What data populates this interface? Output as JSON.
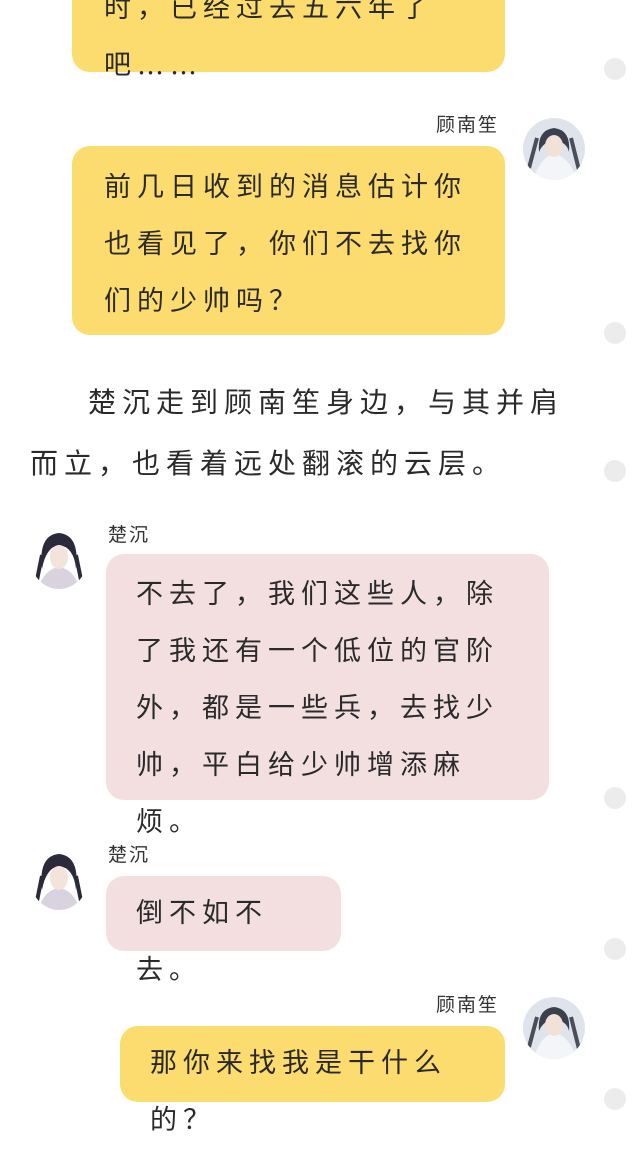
{
  "messages": [
    {
      "speaker": "",
      "text": "时，已经过去五六年了吧……",
      "side": "right",
      "color": "yellow"
    },
    {
      "speaker": "顾南笙",
      "text": "前几日收到的消息估计你也看见了，你们不去找你们的少帅吗？",
      "side": "right",
      "color": "yellow"
    },
    {
      "narration": "楚沉走到顾南笙身边，与其并肩而立，也看着远处翻滚的云层。"
    },
    {
      "speaker": "楚沉",
      "text": "不去了，我们这些人，除了我还有一个低位的官阶外，都是一些兵，去找少帅，平白给少帅增添麻烦。",
      "side": "left",
      "color": "pink"
    },
    {
      "speaker": "楚沉",
      "text": "倒不如不去。",
      "side": "left",
      "color": "pink"
    },
    {
      "speaker": "顾南笙",
      "text": "那你来找我是干什么的？",
      "side": "right",
      "color": "yellow"
    }
  ],
  "avatars": {
    "gu": "顾南笙 avatar",
    "chu": "楚沉 avatar"
  },
  "colors": {
    "yellow_bubble": "#fcdc6e",
    "pink_bubble": "#f3dfe0",
    "scroll_dot": "#ececec"
  }
}
